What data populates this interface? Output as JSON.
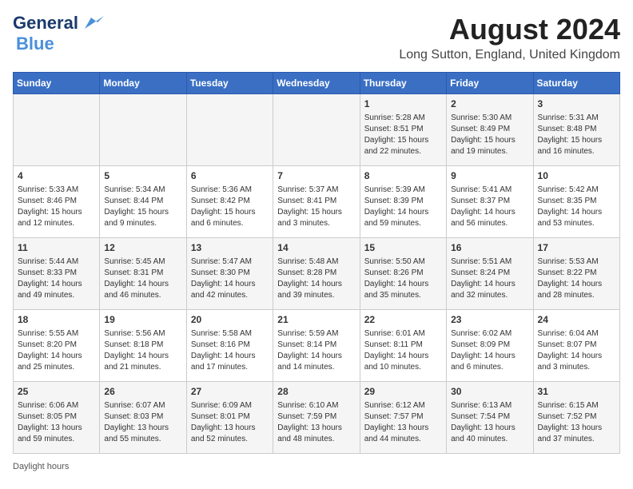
{
  "header": {
    "logo_line1": "General",
    "logo_line2": "Blue",
    "main_title": "August 2024",
    "subtitle": "Long Sutton, England, United Kingdom"
  },
  "columns": [
    "Sunday",
    "Monday",
    "Tuesday",
    "Wednesday",
    "Thursday",
    "Friday",
    "Saturday"
  ],
  "weeks": [
    [
      {
        "day": "",
        "info": ""
      },
      {
        "day": "",
        "info": ""
      },
      {
        "day": "",
        "info": ""
      },
      {
        "day": "",
        "info": ""
      },
      {
        "day": "1",
        "info": "Sunrise: 5:28 AM\nSunset: 8:51 PM\nDaylight: 15 hours and 22 minutes."
      },
      {
        "day": "2",
        "info": "Sunrise: 5:30 AM\nSunset: 8:49 PM\nDaylight: 15 hours and 19 minutes."
      },
      {
        "day": "3",
        "info": "Sunrise: 5:31 AM\nSunset: 8:48 PM\nDaylight: 15 hours and 16 minutes."
      }
    ],
    [
      {
        "day": "4",
        "info": "Sunrise: 5:33 AM\nSunset: 8:46 PM\nDaylight: 15 hours and 12 minutes."
      },
      {
        "day": "5",
        "info": "Sunrise: 5:34 AM\nSunset: 8:44 PM\nDaylight: 15 hours and 9 minutes."
      },
      {
        "day": "6",
        "info": "Sunrise: 5:36 AM\nSunset: 8:42 PM\nDaylight: 15 hours and 6 minutes."
      },
      {
        "day": "7",
        "info": "Sunrise: 5:37 AM\nSunset: 8:41 PM\nDaylight: 15 hours and 3 minutes."
      },
      {
        "day": "8",
        "info": "Sunrise: 5:39 AM\nSunset: 8:39 PM\nDaylight: 14 hours and 59 minutes."
      },
      {
        "day": "9",
        "info": "Sunrise: 5:41 AM\nSunset: 8:37 PM\nDaylight: 14 hours and 56 minutes."
      },
      {
        "day": "10",
        "info": "Sunrise: 5:42 AM\nSunset: 8:35 PM\nDaylight: 14 hours and 53 minutes."
      }
    ],
    [
      {
        "day": "11",
        "info": "Sunrise: 5:44 AM\nSunset: 8:33 PM\nDaylight: 14 hours and 49 minutes."
      },
      {
        "day": "12",
        "info": "Sunrise: 5:45 AM\nSunset: 8:31 PM\nDaylight: 14 hours and 46 minutes."
      },
      {
        "day": "13",
        "info": "Sunrise: 5:47 AM\nSunset: 8:30 PM\nDaylight: 14 hours and 42 minutes."
      },
      {
        "day": "14",
        "info": "Sunrise: 5:48 AM\nSunset: 8:28 PM\nDaylight: 14 hours and 39 minutes."
      },
      {
        "day": "15",
        "info": "Sunrise: 5:50 AM\nSunset: 8:26 PM\nDaylight: 14 hours and 35 minutes."
      },
      {
        "day": "16",
        "info": "Sunrise: 5:51 AM\nSunset: 8:24 PM\nDaylight: 14 hours and 32 minutes."
      },
      {
        "day": "17",
        "info": "Sunrise: 5:53 AM\nSunset: 8:22 PM\nDaylight: 14 hours and 28 minutes."
      }
    ],
    [
      {
        "day": "18",
        "info": "Sunrise: 5:55 AM\nSunset: 8:20 PM\nDaylight: 14 hours and 25 minutes."
      },
      {
        "day": "19",
        "info": "Sunrise: 5:56 AM\nSunset: 8:18 PM\nDaylight: 14 hours and 21 minutes."
      },
      {
        "day": "20",
        "info": "Sunrise: 5:58 AM\nSunset: 8:16 PM\nDaylight: 14 hours and 17 minutes."
      },
      {
        "day": "21",
        "info": "Sunrise: 5:59 AM\nSunset: 8:14 PM\nDaylight: 14 hours and 14 minutes."
      },
      {
        "day": "22",
        "info": "Sunrise: 6:01 AM\nSunset: 8:11 PM\nDaylight: 14 hours and 10 minutes."
      },
      {
        "day": "23",
        "info": "Sunrise: 6:02 AM\nSunset: 8:09 PM\nDaylight: 14 hours and 6 minutes."
      },
      {
        "day": "24",
        "info": "Sunrise: 6:04 AM\nSunset: 8:07 PM\nDaylight: 14 hours and 3 minutes."
      }
    ],
    [
      {
        "day": "25",
        "info": "Sunrise: 6:06 AM\nSunset: 8:05 PM\nDaylight: 13 hours and 59 minutes."
      },
      {
        "day": "26",
        "info": "Sunrise: 6:07 AM\nSunset: 8:03 PM\nDaylight: 13 hours and 55 minutes."
      },
      {
        "day": "27",
        "info": "Sunrise: 6:09 AM\nSunset: 8:01 PM\nDaylight: 13 hours and 52 minutes."
      },
      {
        "day": "28",
        "info": "Sunrise: 6:10 AM\nSunset: 7:59 PM\nDaylight: 13 hours and 48 minutes."
      },
      {
        "day": "29",
        "info": "Sunrise: 6:12 AM\nSunset: 7:57 PM\nDaylight: 13 hours and 44 minutes."
      },
      {
        "day": "30",
        "info": "Sunrise: 6:13 AM\nSunset: 7:54 PM\nDaylight: 13 hours and 40 minutes."
      },
      {
        "day": "31",
        "info": "Sunrise: 6:15 AM\nSunset: 7:52 PM\nDaylight: 13 hours and 37 minutes."
      }
    ]
  ],
  "footer": "Daylight hours"
}
